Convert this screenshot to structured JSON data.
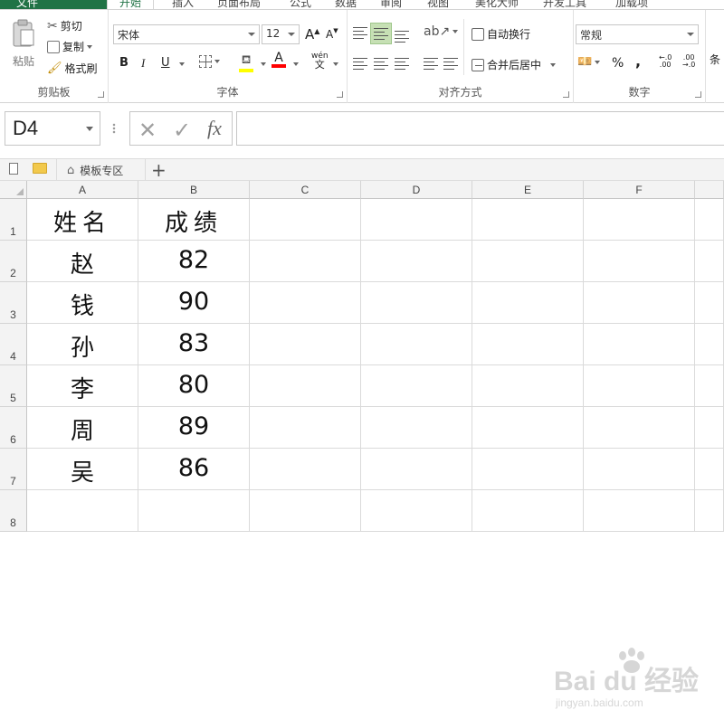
{
  "ribbon_tabs": [
    {
      "label": "文件"
    },
    {
      "label": "开始"
    },
    {
      "label": "插入"
    },
    {
      "label": "页面布局"
    },
    {
      "label": "公式"
    },
    {
      "label": "数据"
    },
    {
      "label": "审阅"
    },
    {
      "label": "视图"
    },
    {
      "label": "美化大师"
    },
    {
      "label": "开发工具"
    },
    {
      "label": "加载项"
    }
  ],
  "clipboard": {
    "paste_label": "粘贴",
    "cut_label": "剪切",
    "copy_label": "复制",
    "format_painter_label": "格式刷",
    "group_label": "剪贴板"
  },
  "font": {
    "font_name": "宋体",
    "font_size": "12",
    "bold": "B",
    "italic": "I",
    "underline": "U",
    "grow": "A",
    "shrink": "A",
    "phonetic": "wén",
    "phonetic_sub": "文",
    "group_label": "字体",
    "highlight_color": "#ffff00",
    "font_color": "#ff0000"
  },
  "alignment": {
    "wrap_text_label": "自动换行",
    "merge_center_label": "合并后居中",
    "group_label": "对齐方式"
  },
  "number": {
    "format": "常规",
    "percent": "%",
    "comma": ",",
    "inc_decimal": "←.0\n.00",
    "dec_decimal": ".00\n→.0",
    "group_label": "数字"
  },
  "styles": {
    "conditional_label": "条"
  },
  "formula_bar": {
    "name_box": "D4",
    "cancel": "✕",
    "enter": "✓",
    "fx": "fx",
    "formula": ""
  },
  "quickbar": {
    "template_label": "模板专区",
    "add": "+"
  },
  "columns": [
    "A",
    "B",
    "C",
    "D",
    "E",
    "F"
  ],
  "rows": [
    "1",
    "2",
    "3",
    "4",
    "5",
    "6",
    "7",
    "8"
  ],
  "cells": {
    "header": {
      "name": "姓名",
      "score": "成绩"
    },
    "data": [
      {
        "name": "赵",
        "score": "82"
      },
      {
        "name": "钱",
        "score": "90"
      },
      {
        "name": "孙",
        "score": "83"
      },
      {
        "name": "李",
        "score": "80"
      },
      {
        "name": "周",
        "score": "89"
      },
      {
        "name": "吴",
        "score": "86"
      }
    ]
  },
  "watermark": {
    "brand": "Bai du 经验",
    "url": "jingyan.baidu.com"
  },
  "colors": {
    "accent": "#217346",
    "selected": "#c6e0b4"
  }
}
